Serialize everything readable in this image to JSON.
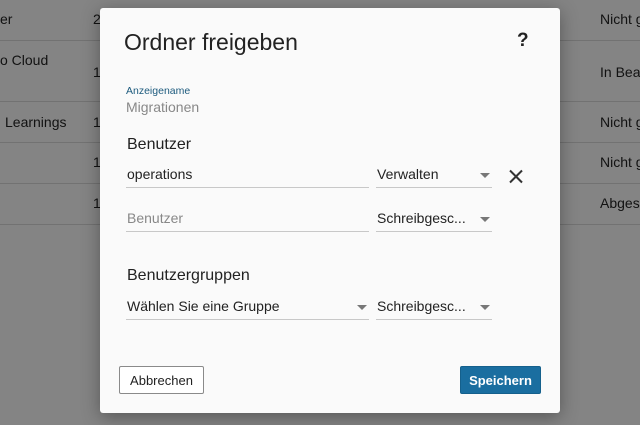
{
  "background": {
    "rows": [
      {
        "name": "er",
        "num": "2",
        "status": "Nicht g"
      },
      {
        "name": "o Cloud",
        "num": "1",
        "status": "In Bear"
      },
      {
        "name": "Learnings",
        "num": "1",
        "status": "Nicht g"
      },
      {
        "name": "",
        "num": "1",
        "status": "Nicht g"
      },
      {
        "name": "",
        "num": "1",
        "status": "Abges"
      }
    ]
  },
  "dialog": {
    "title": "Ordner freigeben",
    "help": "?",
    "display_name_label": "Anzeigename",
    "display_name_value": "Migrationen",
    "users_heading": "Benutzer",
    "users": [
      {
        "value": "operations",
        "permission": "Verwalten"
      }
    ],
    "new_user": {
      "placeholder": "Benutzer",
      "permission": "Schreibgesc..."
    },
    "groups_heading": "Benutzergruppen",
    "group": {
      "select": "Wählen Sie eine Gruppe",
      "permission": "Schreibgesc..."
    },
    "cancel_label": "Abbrechen",
    "save_label": "Speichern"
  },
  "colors": {
    "primary": "#1a6ea0",
    "label": "#1c5a7d"
  }
}
